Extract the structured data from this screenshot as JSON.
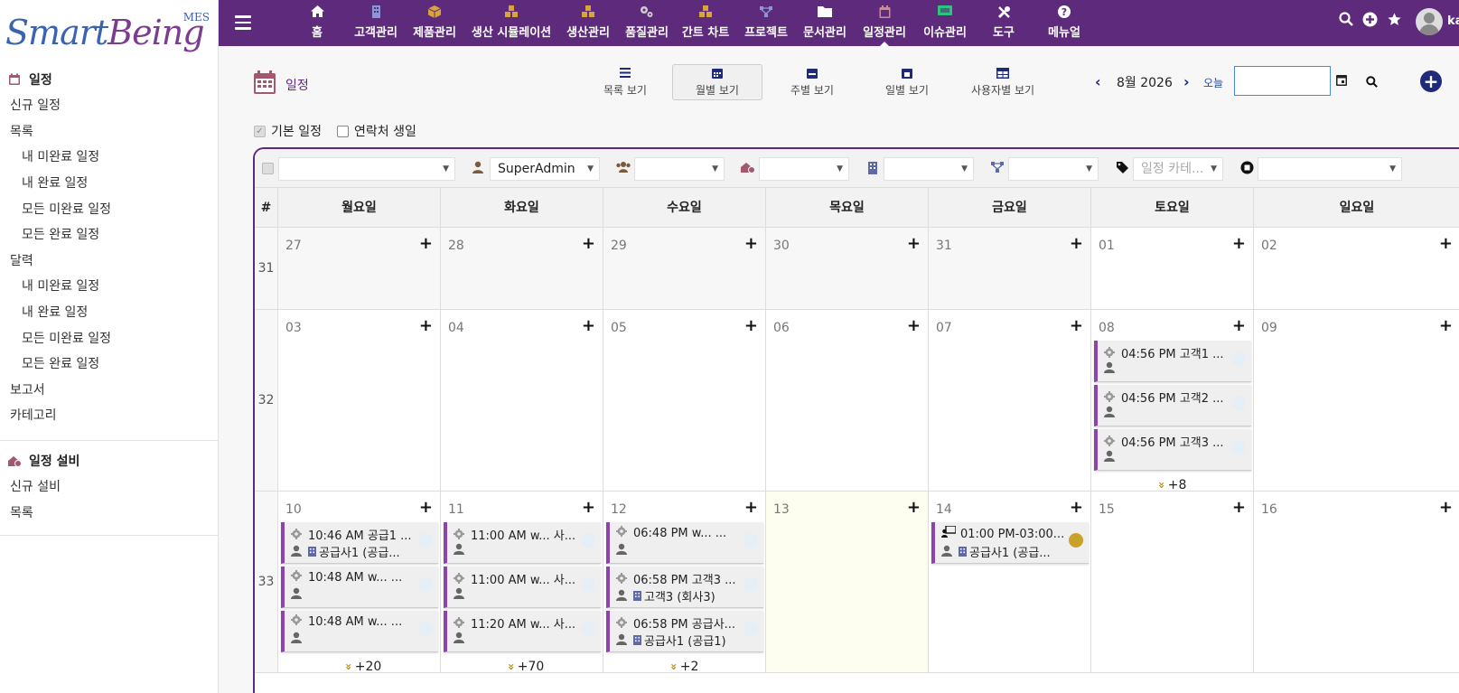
{
  "logo": {
    "mes": "MES",
    "part1": "Smart",
    "part2": "Being"
  },
  "sidebar": {
    "schedule_title": "일정",
    "schedule_items": [
      "신규 일정",
      "목록",
      "내 미완료 일정",
      "내 완료 일정",
      "모든 미완료 일정",
      "모든 완료 일정",
      "달력",
      "내 미완료 일정",
      "내 완료 일정",
      "모든 미완료 일정",
      "모든 완료 일정",
      "보고서",
      "카테고리"
    ],
    "facility_title": "일정 설비",
    "facility_items": [
      "신규 설비",
      "목록"
    ]
  },
  "nav": {
    "items": [
      {
        "icon": "home-icon",
        "label": "홈"
      },
      {
        "icon": "building-icon",
        "label": "고객관리"
      },
      {
        "icon": "box-icon",
        "label": "제품관리"
      },
      {
        "icon": "cubes-icon",
        "label": "생산 시뮬레이션"
      },
      {
        "icon": "cubes-icon",
        "label": "생산관리"
      },
      {
        "icon": "cogs-icon",
        "label": "품질관리"
      },
      {
        "icon": "cubes-icon",
        "label": "간트 차트"
      },
      {
        "icon": "project-icon",
        "label": "프로젝트"
      },
      {
        "icon": "folder-icon",
        "label": "문서관리"
      },
      {
        "icon": "calendar-icon",
        "label": "일정관리"
      },
      {
        "icon": "ticket-icon",
        "label": "이슈관리"
      },
      {
        "icon": "tools-icon",
        "label": "도구"
      },
      {
        "icon": "help-icon",
        "label": "메뉴얼"
      }
    ],
    "active": "일정관리",
    "username": "ka"
  },
  "page": {
    "title": "일정",
    "views": [
      "목록 보기",
      "월별 보기",
      "주별 보기",
      "일별 보기",
      "사용자별 보기"
    ],
    "active_view": "월별 보기",
    "month": "8월 2026",
    "today": "오늘",
    "date_value": "",
    "checkboxes": [
      {
        "label": "기본 일정",
        "checked": true
      },
      {
        "label": "연락처 생일",
        "checked": false
      }
    ]
  },
  "filters": {
    "user": "SuperAdmin",
    "category_placeholder": "일정 카테..."
  },
  "calendar": {
    "hash": "#",
    "weekdays": [
      "월요일",
      "화요일",
      "수요일",
      "목요일",
      "금요일",
      "토요일",
      "일요일"
    ],
    "weeks": [
      {
        "num": "31",
        "days": [
          {
            "d": "27",
            "other": true
          },
          {
            "d": "28",
            "other": true
          },
          {
            "d": "29",
            "other": true
          },
          {
            "d": "30",
            "other": true
          },
          {
            "d": "31",
            "other": true
          },
          {
            "d": "01"
          },
          {
            "d": "02"
          }
        ]
      },
      {
        "num": "32",
        "days": [
          {
            "d": "03"
          },
          {
            "d": "04"
          },
          {
            "d": "05"
          },
          {
            "d": "06"
          },
          {
            "d": "07"
          },
          {
            "d": "08",
            "events": [
              {
                "t": "04:56 PM 고객1 ...",
                "s": "",
                "icon": "gear"
              },
              {
                "t": "04:56 PM 고객2 ...",
                "s": "",
                "icon": "gear"
              },
              {
                "t": "04:56 PM 고객3 ...",
                "s": "",
                "icon": "gear"
              }
            ],
            "more": "+8"
          },
          {
            "d": "09"
          }
        ]
      },
      {
        "num": "33",
        "days": [
          {
            "d": "10",
            "events": [
              {
                "t": "10:46 AM 공급1 ...",
                "s": "공급사1 (공급...",
                "icon": "gear"
              },
              {
                "t": "10:48 AM w... ...",
                "s": "",
                "icon": "gear"
              },
              {
                "t": "10:48 AM w... ...",
                "s": "",
                "icon": "gear"
              }
            ],
            "more": "+20"
          },
          {
            "d": "11",
            "events": [
              {
                "t": "11:00 AM w... 사...",
                "s": "",
                "icon": "gear"
              },
              {
                "t": "11:00 AM w... 사...",
                "s": "",
                "icon": "gear"
              },
              {
                "t": "11:20 AM w... 사...",
                "s": "",
                "icon": "gear"
              }
            ],
            "more": "+70"
          },
          {
            "d": "12",
            "events": [
              {
                "t": "06:48 PM w... ...",
                "s": "",
                "icon": "gear"
              },
              {
                "t": "06:58 PM 고객3 ...",
                "s": "고객3 (회사3)",
                "icon": "gear"
              },
              {
                "t": "06:58 PM 공급사...",
                "s": "공급사1 (공급1)",
                "icon": "gear"
              }
            ],
            "more": "+2"
          },
          {
            "d": "13",
            "today": true
          },
          {
            "d": "14",
            "events": [
              {
                "t": "01:00 PM-03:00...",
                "s": "공급사1 (공급...",
                "icon": "meeting",
                "gold": true
              }
            ]
          },
          {
            "d": "15"
          },
          {
            "d": "16"
          }
        ]
      }
    ]
  }
}
